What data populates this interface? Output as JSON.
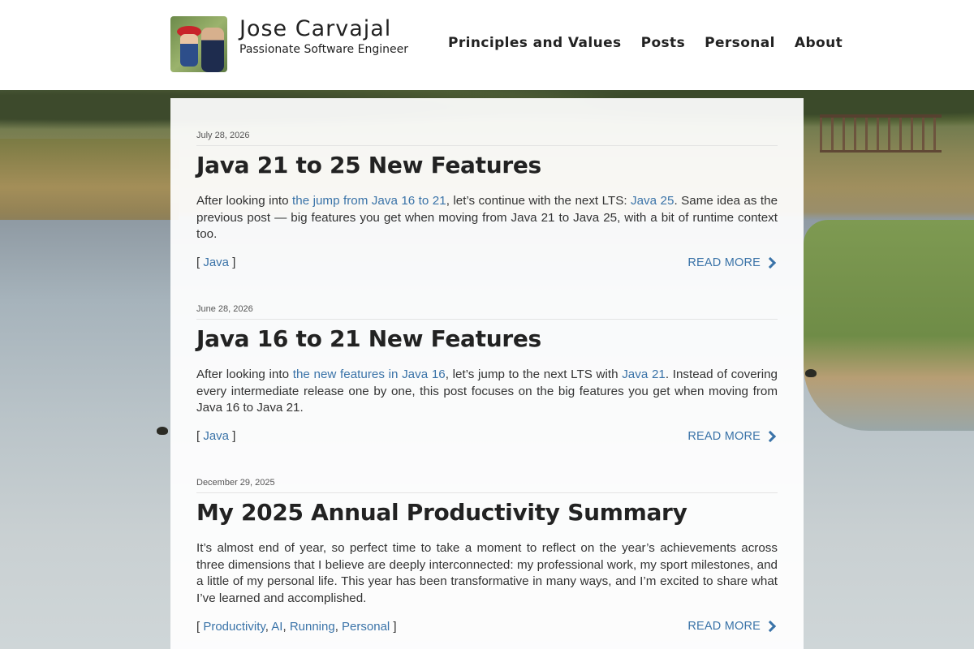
{
  "header": {
    "title": "Jose Carvajal",
    "tagline": "Passionate Software Engineer",
    "nav": [
      {
        "label": "Principles and Values"
      },
      {
        "label": "Posts"
      },
      {
        "label": "Personal"
      },
      {
        "label": "About"
      }
    ]
  },
  "posts": [
    {
      "date": "July 28, 2026",
      "title": "Java 21 to 25 New Features",
      "summary": {
        "t1": "After looking into ",
        "l1": "the jump from Java 16 to 21",
        "t2": ", let’s continue with the next LTS: ",
        "l2": "Java 25",
        "t3": ". Same idea as the previous post — big features you get when moving from Java 21 to Java 25, with a bit of runtime context too."
      },
      "tags": [
        "Java"
      ],
      "read_more": "READ MORE"
    },
    {
      "date": "June 28, 2026",
      "title": "Java 16 to 21 New Features",
      "summary": {
        "t1": "After looking into ",
        "l1": "the new features in Java 16",
        "t2": ", let’s jump to the next LTS with ",
        "l2": "Java 21",
        "t3": ". Instead of covering every intermediate release one by one, this post focuses on the big features you get when moving from Java 16 to Java 21."
      },
      "tags": [
        "Java"
      ],
      "read_more": "READ MORE"
    },
    {
      "date": "December 29, 2025",
      "title": "My 2025 Annual Productivity Summary",
      "summary": {
        "t1": "It’s almost end of year, so perfect time to take a moment to reflect on the year’s achievements across three dimensions that I believe are deeply interconnected: my professional work, my sport milestones, and a little of my personal life. This year has been transformative in many ways, and I’m excited to share what I’ve learned and accomplished.",
        "l1": "",
        "t2": "",
        "l2": "",
        "t3": ""
      },
      "tags": [
        "Productivity",
        "AI",
        "Running",
        "Personal"
      ],
      "read_more": "READ MORE"
    }
  ],
  "colors": {
    "link": "#3a73a8",
    "text": "#222222"
  }
}
